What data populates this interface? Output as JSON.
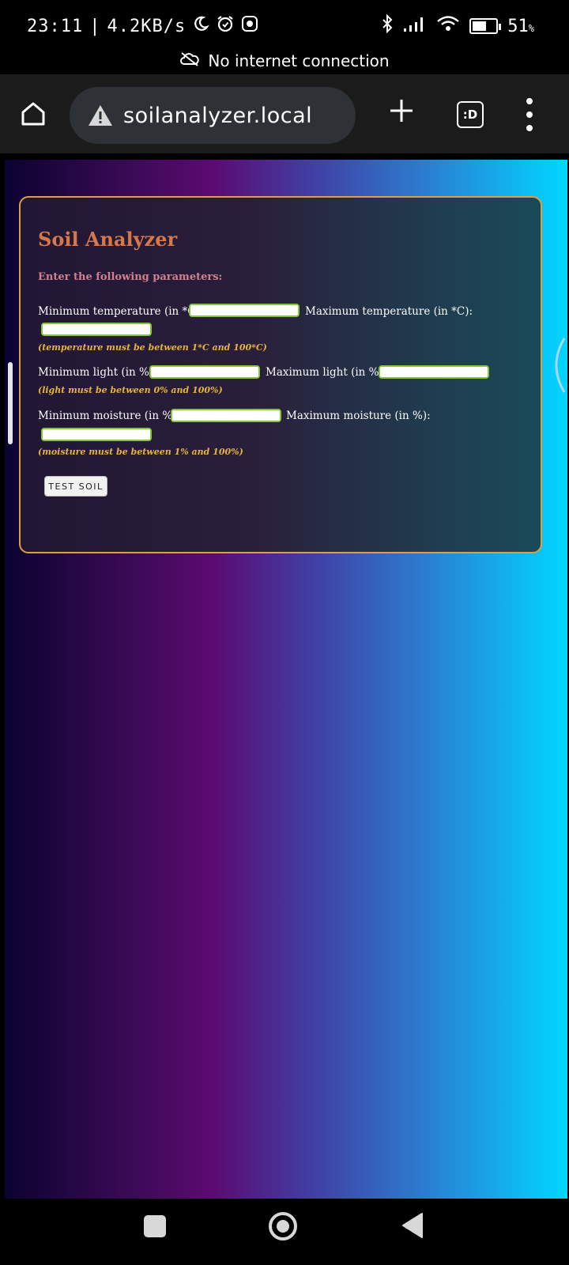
{
  "status_bar": {
    "time": "23:11",
    "speed": "4.2KB/s",
    "battery_text": "51",
    "battery_unit": "%",
    "battery_level": 0.51,
    "icons": [
      "moon-icon",
      "alarm-icon",
      "app-notification-icon",
      "bluetooth-icon",
      "signal-icon",
      "wifi-icon",
      "battery-icon"
    ]
  },
  "offline": {
    "text": "No internet connection"
  },
  "browser": {
    "url": "soilanalyzer.local",
    "tabs_label": ":D"
  },
  "form": {
    "title": "Soil Analyzer",
    "subtitle": "Enter the following parameters:",
    "min_temp_label": "Minimum temperature (in *C):",
    "max_temp_label": "Maximum temperature (in *C):",
    "temp_hint": "(temperature must be between 1*C and 100*C)",
    "min_light_label": "Minimum light (in %):",
    "max_light_label": "Maximum light (in %):",
    "light_hint": "(light must be between 0% and 100%)",
    "min_moisture_label": "Minimum moisture (in %):",
    "max_moisture_label": "Maximum moisture (in %):",
    "moisture_hint": "(moisture must be between 1% and 100%)",
    "submit_label": "TEST SOIL",
    "values": {
      "min_temp": "",
      "max_temp": "",
      "min_light": "",
      "max_light": "",
      "min_moisture": "",
      "max_moisture": ""
    }
  },
  "colors": {
    "card_border": "#d9a046",
    "title": "#d6784a",
    "hint": "#e8b33a",
    "input_border": "#86c43a"
  }
}
